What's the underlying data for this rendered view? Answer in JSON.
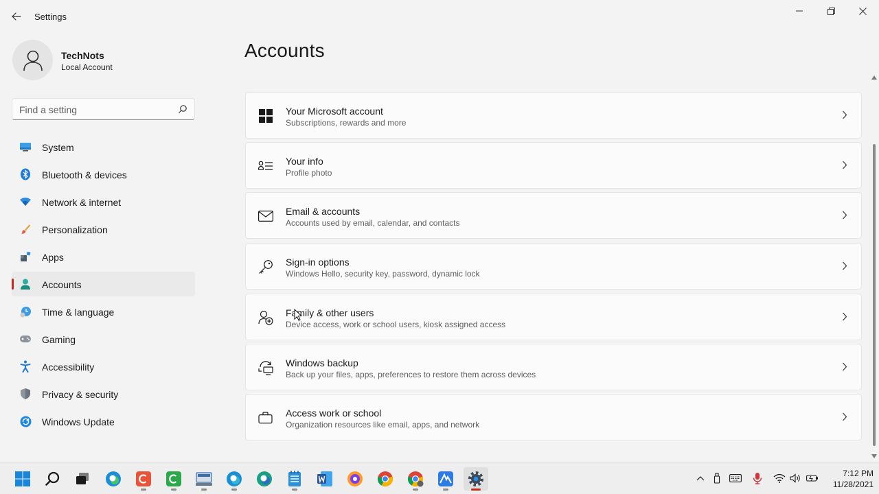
{
  "window": {
    "title": "Settings",
    "back_icon": "arrow-left-icon",
    "controls": [
      "minimize-icon",
      "restore-icon",
      "close-icon"
    ]
  },
  "profile": {
    "name": "TechNots",
    "account_type": "Local Account",
    "avatar_icon": "person-icon"
  },
  "search": {
    "placeholder": "Find a setting",
    "value": "",
    "icon": "search-icon"
  },
  "nav": {
    "items": [
      {
        "label": "System",
        "icon": "monitor-icon",
        "active": false
      },
      {
        "label": "Bluetooth & devices",
        "icon": "bluetooth-icon",
        "active": false
      },
      {
        "label": "Network & internet",
        "icon": "wifi-icon",
        "active": false
      },
      {
        "label": "Personalization",
        "icon": "brush-icon",
        "active": false
      },
      {
        "label": "Apps",
        "icon": "apps-icon",
        "active": false
      },
      {
        "label": "Accounts",
        "icon": "person-icon",
        "active": true
      },
      {
        "label": "Time & language",
        "icon": "clock-globe-icon",
        "active": false
      },
      {
        "label": "Gaming",
        "icon": "gamepad-icon",
        "active": false
      },
      {
        "label": "Accessibility",
        "icon": "accessibility-icon",
        "active": false
      },
      {
        "label": "Privacy & security",
        "icon": "shield-icon",
        "active": false
      },
      {
        "label": "Windows Update",
        "icon": "update-icon",
        "active": false
      }
    ]
  },
  "main": {
    "title": "Accounts",
    "cards": [
      {
        "title": "Your Microsoft account",
        "subtitle": "Subscriptions, rewards and more",
        "icon": "windows-logo-icon"
      },
      {
        "title": "Your info",
        "subtitle": "Profile photo",
        "icon": "contact-card-icon"
      },
      {
        "title": "Email & accounts",
        "subtitle": "Accounts used by email, calendar, and contacts",
        "icon": "mail-icon"
      },
      {
        "title": "Sign-in options",
        "subtitle": "Windows Hello, security key, password, dynamic lock",
        "icon": "key-icon"
      },
      {
        "title": "Family & other users",
        "subtitle": "Device access, work or school users, kiosk assigned access",
        "icon": "add-person-icon"
      },
      {
        "title": "Windows backup",
        "subtitle": "Back up your files, apps, preferences to restore them across devices",
        "icon": "backup-sync-icon"
      },
      {
        "title": "Access work or school",
        "subtitle": "Organization resources like email, apps, and network",
        "icon": "briefcase-icon"
      }
    ]
  },
  "taskbar": {
    "apps": [
      {
        "name": "start-icon",
        "color": "#0078d4",
        "running": false
      },
      {
        "name": "search-icon",
        "color": "#1a1a1a",
        "running": false
      },
      {
        "name": "task-view-icon",
        "color": "#1a1a1a",
        "running": false
      },
      {
        "name": "edge-icon",
        "color": "#1b8fd6",
        "running": false
      },
      {
        "name": "editor-red-icon",
        "color": "#e8543a",
        "running": true
      },
      {
        "name": "editor-green-icon",
        "color": "#2aa84a",
        "running": true
      },
      {
        "name": "explorer-icon",
        "color": "#3a6fb0",
        "running": true
      },
      {
        "name": "edge-beta-icon",
        "color": "#1b8fd6",
        "running": true
      },
      {
        "name": "edge-dev-icon",
        "color": "#17a083",
        "running": false
      },
      {
        "name": "notes-icon",
        "color": "#2b8fd9",
        "running": true
      },
      {
        "name": "word-icon",
        "color": "#2b579a",
        "running": false
      },
      {
        "name": "firefox-icon",
        "color": "#7b3ff2",
        "running": false
      },
      {
        "name": "chrome-icon",
        "color": "#db4437",
        "running": false
      },
      {
        "name": "chrome-profile-icon",
        "color": "#db4437",
        "running": true
      },
      {
        "name": "azure-icon",
        "color": "#2d7be5",
        "running": true
      },
      {
        "name": "settings-gear-icon",
        "color": "#3c4a5a",
        "running": true,
        "active": true
      }
    ],
    "tray_icons": [
      "chevron-up-icon",
      "usb-icon",
      "keyboard-icon",
      "microphone-icon",
      "wifi-icon",
      "volume-icon",
      "battery-icon"
    ],
    "time": "7:12 PM",
    "date": "11/28/2021"
  }
}
